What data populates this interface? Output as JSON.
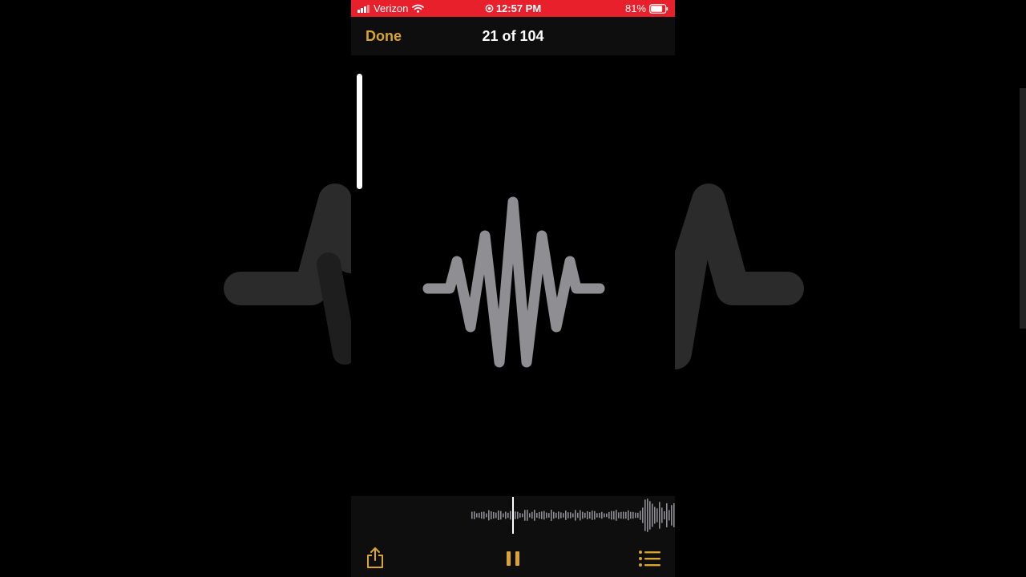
{
  "status_bar": {
    "carrier": "Verizon",
    "time": "12:57 PM",
    "battery_percent": "81%",
    "battery_level": 0.81,
    "signal_bars": 3,
    "icons": [
      "signal-icon",
      "wifi-icon",
      "location-icon",
      "battery-icon"
    ]
  },
  "nav": {
    "done_label": "Done",
    "title": "21 of 104"
  },
  "colors": {
    "status_bar": "#e8202b",
    "accent": "#d9a52b",
    "waveform": "#8e8e93",
    "background": "#000000"
  },
  "viewer": {
    "image_icon": "waveform-icon"
  },
  "player": {
    "playhead_icon": "playhead-line",
    "toolbar": {
      "share_icon": "share-icon",
      "pause_icon": "pause-icon",
      "list_icon": "list-icon"
    }
  }
}
